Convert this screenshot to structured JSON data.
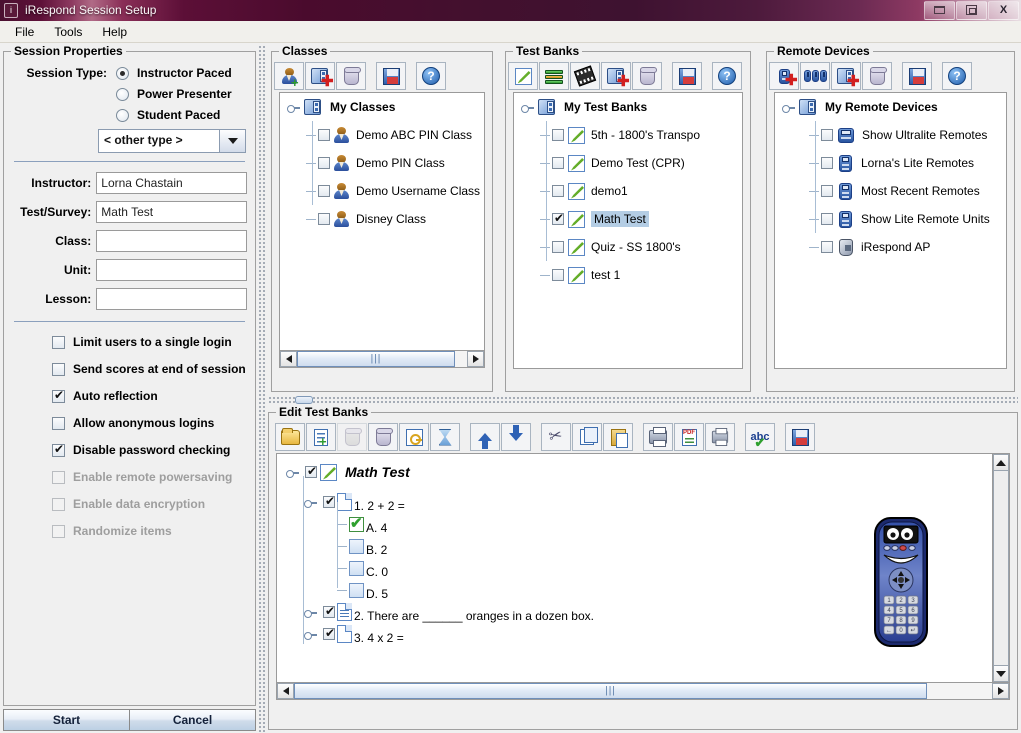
{
  "window": {
    "title": "iRespond Session Setup",
    "icon": "app-icon",
    "buttons": {
      "minimize": "minimize",
      "restore": "restore",
      "close": "X"
    }
  },
  "menu": {
    "items": [
      "File",
      "Tools",
      "Help"
    ]
  },
  "session": {
    "title": "Session Properties",
    "session_type_label": "Session Type:",
    "radios": [
      {
        "label": "Instructor Paced",
        "selected": true
      },
      {
        "label": "Power Presenter",
        "selected": false
      },
      {
        "label": "Student Paced",
        "selected": false
      }
    ],
    "other_type": {
      "value": "< other type >"
    },
    "fields": [
      {
        "label": "Instructor:",
        "value": "Lorna Chastain",
        "placeholder": ""
      },
      {
        "label": "Test/Survey:",
        "value": "Math Test",
        "placeholder": ""
      },
      {
        "label": "Class:",
        "value": "",
        "placeholder": ""
      },
      {
        "label": "Unit:",
        "value": "",
        "placeholder": ""
      },
      {
        "label": "Lesson:",
        "value": "",
        "placeholder": ""
      }
    ],
    "checkboxes": [
      {
        "label": "Limit users to a single login",
        "checked": false,
        "enabled": true
      },
      {
        "label": "Send scores at end of session",
        "checked": false,
        "enabled": true
      },
      {
        "label": "Auto reflection",
        "checked": true,
        "enabled": true
      },
      {
        "label": "Allow anonymous logins",
        "checked": false,
        "enabled": true
      },
      {
        "label": "Disable password checking",
        "checked": true,
        "enabled": true
      },
      {
        "label": "Enable remote powersaving",
        "checked": false,
        "enabled": false
      },
      {
        "label": "Enable data encryption",
        "checked": false,
        "enabled": false
      },
      {
        "label": "Randomize items",
        "checked": false,
        "enabled": false
      }
    ],
    "start_button": "Start",
    "cancel_button": "Cancel"
  },
  "classes": {
    "title": "Classes",
    "toolbar": [
      "add-class-icon",
      "add-folder-icon",
      "delete-icon",
      "save-icon",
      "help-icon"
    ],
    "root": "My Classes",
    "items": [
      {
        "label": "Demo ABC PIN Class",
        "checked": false
      },
      {
        "label": "Demo PIN Class",
        "checked": false
      },
      {
        "label": "Demo Username Class",
        "checked": false
      },
      {
        "label": "Disney Class",
        "checked": false
      }
    ]
  },
  "testbanks": {
    "title": "Test Banks",
    "toolbar": [
      "edit-test-icon",
      "books-icon",
      "media-icon",
      "add-folder-icon",
      "delete-icon",
      "save-icon",
      "help-icon"
    ],
    "root": "My Test Banks",
    "items": [
      {
        "label": "5th - 1800's Transpo",
        "checked": false,
        "selected": false
      },
      {
        "label": "Demo Test (CPR)",
        "checked": false,
        "selected": false
      },
      {
        "label": "demo1",
        "checked": false,
        "selected": false
      },
      {
        "label": "Math Test",
        "checked": true,
        "selected": true
      },
      {
        "label": "Quiz - SS 1800's",
        "checked": false,
        "selected": false
      },
      {
        "label": "test 1",
        "checked": false,
        "selected": false
      }
    ]
  },
  "remotes": {
    "title": "Remote Devices",
    "toolbar": [
      "add-remote-icon",
      "add-remote-group-icon",
      "add-folder-icon",
      "delete-icon",
      "save-icon",
      "help-icon"
    ],
    "root": "My Remote Devices",
    "items": [
      {
        "label": "Show Ultralite Remotes",
        "checked": false,
        "icon": "ultralite-remote-icon"
      },
      {
        "label": "Lorna's Lite Remotes",
        "checked": false,
        "icon": "lite-remote-icon"
      },
      {
        "label": "Most Recent Remotes",
        "checked": false,
        "icon": "lite-remote-icon"
      },
      {
        "label": "Show Lite Remote Units",
        "checked": false,
        "icon": "lite-remote-icon"
      },
      {
        "label": "iRespond AP",
        "checked": false,
        "icon": "access-point-icon"
      }
    ]
  },
  "edit": {
    "title": "Edit Test Banks",
    "toolbar": [
      "open-folder-icon",
      "add-question-icon",
      "add-group-icon",
      "delete-icon",
      "answer-key-icon",
      "timer-icon",
      "move-up-icon",
      "move-down-icon",
      "cut-icon",
      "copy-icon",
      "paste-icon",
      "print-icon",
      "pdf-icon",
      "print-preview-icon",
      "spellcheck-icon",
      "save-icon"
    ],
    "tree": {
      "root": {
        "label": "Math Test",
        "checked": true
      },
      "questions": [
        {
          "label": "1. 2 + 2 =",
          "checked": true,
          "type": "multiple-choice",
          "answers": [
            {
              "label": "A. 4",
              "correct": true
            },
            {
              "label": "B. 2",
              "correct": false
            },
            {
              "label": "C. 0",
              "correct": false
            },
            {
              "label": "D. 5",
              "correct": false
            }
          ]
        },
        {
          "label": "2. There are ______ oranges in a dozen box.",
          "checked": true,
          "type": "fill-in",
          "answers": []
        },
        {
          "label": "3. 4 x 2 =",
          "checked": true,
          "type": "multiple-choice",
          "answers": []
        }
      ]
    },
    "artwork": "cartoon-remote-mascot"
  }
}
